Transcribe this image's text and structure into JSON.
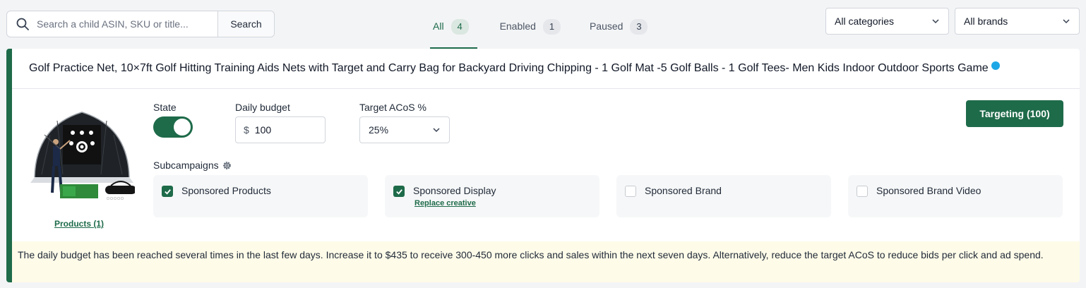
{
  "search": {
    "placeholder": "Search a child ASIN, SKU or title...",
    "button_label": "Search"
  },
  "tabs": [
    {
      "label": "All",
      "count": "4",
      "active": true
    },
    {
      "label": "Enabled",
      "count": "1",
      "active": false
    },
    {
      "label": "Paused",
      "count": "3",
      "active": false
    }
  ],
  "filters": {
    "category": "All categories",
    "brand": "All brands"
  },
  "product": {
    "title": "Golf Practice Net, 10×7ft Golf Hitting Training Aids Nets with Target and Carry Bag for Backyard Driving Chipping - 1 Golf Mat -5 Golf Balls - 1 Golf Tees- Men Kids Indoor Outdoor Sports Game",
    "products_link": "Products (1)",
    "state_label": "State",
    "state_on": true,
    "budget_label": "Daily budget",
    "currency": "$",
    "budget_value": "100",
    "acos_label": "Target ACoS %",
    "acos_value": "25%",
    "targeting_button": "Targeting (100)",
    "subcampaigns_label": "Subcampaigns",
    "subcampaigns": [
      {
        "label": "Sponsored Products",
        "checked": true
      },
      {
        "label": "Sponsored Display",
        "checked": true,
        "link": "Replace creative"
      },
      {
        "label": "Sponsored Brand",
        "checked": false
      },
      {
        "label": "Sponsored Brand Video",
        "checked": false
      }
    ],
    "notice": "The daily budget has been reached several times in the last few days. Increase it to $435 to receive 300-450 more clicks and sales within the next seven days. Alternatively, reduce the target ACoS to reduce bids per click and ad spend."
  },
  "colors": {
    "accent": "#1e6b4a",
    "status_dot": "#1ea7e6",
    "notice_bg": "#fefbe8"
  }
}
